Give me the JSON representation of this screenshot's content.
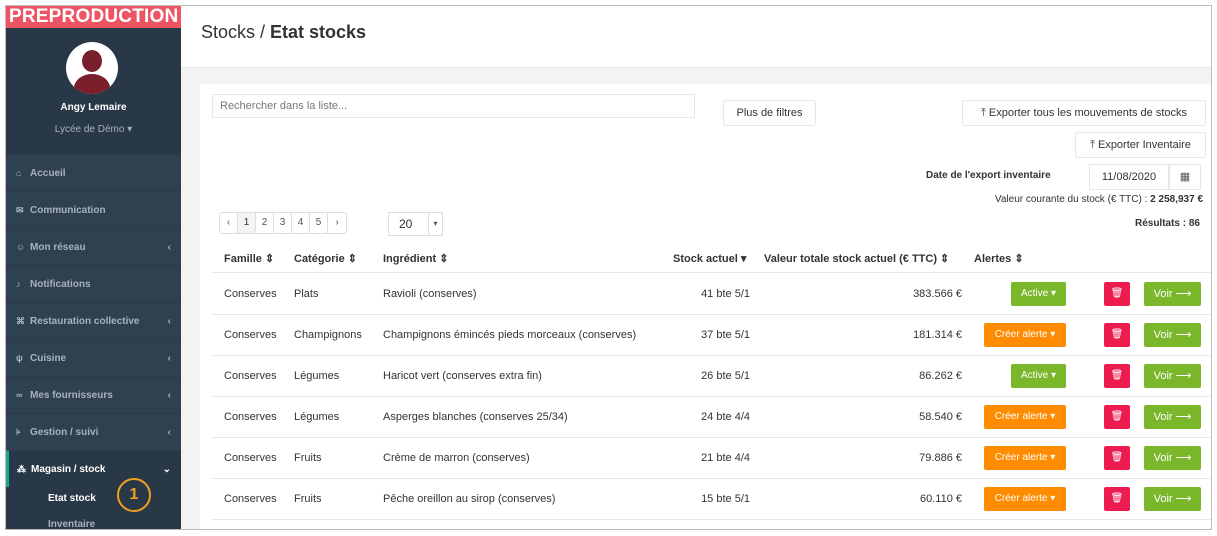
{
  "sidebar": {
    "banner": "PREPRODUCTION",
    "user_name": "Angy Lemaire",
    "school": "Lycée de Démo ▾",
    "items": [
      {
        "icon": "home-icon",
        "glyph": "⌂",
        "label": "Accueil",
        "chev": ""
      },
      {
        "icon": "comments-icon",
        "glyph": "✉",
        "label": "Communication",
        "chev": ""
      },
      {
        "icon": "users-icon",
        "glyph": "☺",
        "label": "Mon réseau",
        "chev": "‹"
      },
      {
        "icon": "bell-icon",
        "glyph": "♪",
        "label": "Notifications",
        "chev": ""
      },
      {
        "icon": "building-icon",
        "glyph": "⌘",
        "label": "Restauration collective",
        "chev": "‹"
      },
      {
        "icon": "cutlery-icon",
        "glyph": "ψ",
        "label": "Cuisine",
        "chev": "‹"
      },
      {
        "icon": "handshake-icon",
        "glyph": "∞",
        "label": "Mes fournisseurs",
        "chev": "‹"
      },
      {
        "icon": "cart-icon",
        "glyph": "⊧",
        "label": "Gestion / suivi",
        "chev": "‹"
      },
      {
        "icon": "cubes-icon",
        "glyph": "⁂",
        "label": "Magasin / stock",
        "chev": "⌄"
      }
    ],
    "subitems": [
      "Etat stock",
      "Inventaire"
    ],
    "step_marker": "1"
  },
  "header": {
    "crumb_parent": "Stocks / ",
    "crumb_current": "Etat stocks"
  },
  "toolbar": {
    "search_placeholder": "Rechercher dans la liste...",
    "more_filters": "Plus de filtres",
    "export_all": "⤒ Exporter tous les mouvements de stocks",
    "export_inventory": "⤒ Exporter Inventaire",
    "date_label": "Date de l'export inventaire",
    "date_value": "11/08/2020",
    "calendar_glyph": "▦",
    "stock_value_label": "Valeur courante du stock (€ TTC) : ",
    "stock_value": "2 258,937 €",
    "results": "Résultats : 86"
  },
  "pager": {
    "prev": "‹",
    "pages": [
      "1",
      "2",
      "3",
      "4",
      "5"
    ],
    "next": "›",
    "per_page": "20"
  },
  "table": {
    "headers": [
      "Famille ⇕",
      "Catégorie ⇕",
      "Ingrédient ⇕",
      "Stock actuel ▾",
      "Valeur totale stock actuel (€ TTC) ⇕",
      "Alertes ⇕"
    ],
    "rows": [
      {
        "famille": "Conserves",
        "categorie": "Plats",
        "ingredient": "Ravioli (conserves)",
        "stock": "41 bte 5/1",
        "valeur": "383.566 €",
        "alerte": "Active ▾",
        "alerte_type": "active"
      },
      {
        "famille": "Conserves",
        "categorie": "Champignons",
        "ingredient": "Champignons émincés pieds morceaux (conserves)",
        "stock": "37 bte 5/1",
        "valeur": "181.314 €",
        "alerte": "Créer alerte ▾",
        "alerte_type": "create"
      },
      {
        "famille": "Conserves",
        "categorie": "Légumes",
        "ingredient": "Haricot vert (conserves extra fin)",
        "stock": "26 bte 5/1",
        "valeur": "86.262 €",
        "alerte": "Active ▾",
        "alerte_type": "active"
      },
      {
        "famille": "Conserves",
        "categorie": "Légumes",
        "ingredient": "Asperges blanches (conserves 25/34)",
        "stock": "24 bte 4/4",
        "valeur": "58.540 €",
        "alerte": "Créer alerte ▾",
        "alerte_type": "create"
      },
      {
        "famille": "Conserves",
        "categorie": "Fruits",
        "ingredient": "Crème de marron (conserves)",
        "stock": "21 bte 4/4",
        "valeur": "79.886 €",
        "alerte": "Créer alerte ▾",
        "alerte_type": "create"
      },
      {
        "famille": "Conserves",
        "categorie": "Fruits",
        "ingredient": "Pêche oreillon au sirop (conserves)",
        "stock": "15 bte 5/1",
        "valeur": "60.110 €",
        "alerte": "Créer alerte ▾",
        "alerte_type": "create"
      }
    ],
    "delete_glyph": "🗑",
    "view_label": "Voir ⟶"
  },
  "colors": {
    "sidebar": "#2f4050",
    "banner": "#ed5565",
    "active_green": "#7ab72a",
    "create_orange": "#ff8c00",
    "delete_red": "#ed1c4f",
    "step_marker": "#f0a020"
  }
}
